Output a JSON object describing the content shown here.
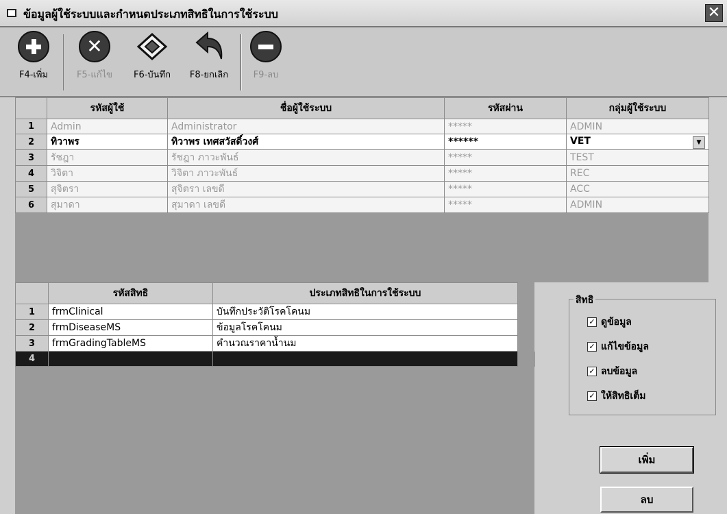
{
  "window": {
    "title": "ข้อมูลผู้ใช้ระบบและกำหนดประเภทสิทธิในการใช้ระบบ",
    "close_glyph": "✕"
  },
  "toolbar": {
    "add_label": "F4-เพิ่ม",
    "edit_label": "F5-แก้ไข",
    "save_label": "F6-บันทึก",
    "cancel_label": "F8-ยกเลิก",
    "delete_label": "F9-ลบ",
    "icons": {
      "add": "plus-circle-icon",
      "edit": "x-circle-icon",
      "save": "diskette-icon",
      "cancel": "undo-arrow-icon",
      "delete": "minus-circle-icon"
    }
  },
  "users_table": {
    "headers": [
      "รหัสผู้ใช้",
      "ชื่อผู้ใช้ระบบ",
      "รหัสผ่าน",
      "กลุ่มผู้ใช้ระบบ"
    ],
    "rows": [
      {
        "n": "1",
        "code": "Admin",
        "name": "Administrator",
        "password": "*****",
        "group": "ADMIN"
      },
      {
        "n": "2",
        "code": "ทิวาพร",
        "name": "ทิวาพร เทศสวัสดิ์วงศ์",
        "password": "******",
        "group": "VET"
      },
      {
        "n": "3",
        "code": "รัชฎา",
        "name": "รัชฎา ภาวะพันธ์",
        "password": "*****",
        "group": "TEST"
      },
      {
        "n": "4",
        "code": "วิจิตา",
        "name": "วิจิตา ภาวะพันธ์",
        "password": "*****",
        "group": "REC"
      },
      {
        "n": "5",
        "code": "สุจิตรา",
        "name": "สุจิตรา เลขดี",
        "password": "*****",
        "group": "ACC"
      },
      {
        "n": "6",
        "code": "สุมาดา",
        "name": "สุมาดา เลขดี",
        "password": "*****",
        "group": "ADMIN"
      }
    ]
  },
  "rights_table": {
    "headers": [
      "รหัสสิทธิ",
      "ประเภทสิทธิในการใช้ระบบ"
    ],
    "rows": [
      {
        "n": "1",
        "code": "frmClinical",
        "desc": "บันทึกประวัติโรคโคนม"
      },
      {
        "n": "2",
        "code": "frmDiseaseMS",
        "desc": "ข้อมูลโรคโคนม"
      },
      {
        "n": "3",
        "code": "frmGradingTableMS",
        "desc": "คำนวณราคาน้ำนม"
      },
      {
        "n": "4",
        "code": "",
        "desc": ""
      }
    ]
  },
  "rights_group": {
    "title": "สิทธิ",
    "checkboxes": [
      {
        "label": "ดูข้อมูล",
        "checked": true
      },
      {
        "label": "แก้ไขข้อมูล",
        "checked": true
      },
      {
        "label": "ลบข้อมูล",
        "checked": true
      },
      {
        "label": "ให้สิทธิเต็ม",
        "checked": true
      }
    ],
    "check_glyph": "✓"
  },
  "buttons": {
    "add": "เพิ่ม",
    "delete": "ลบ"
  }
}
